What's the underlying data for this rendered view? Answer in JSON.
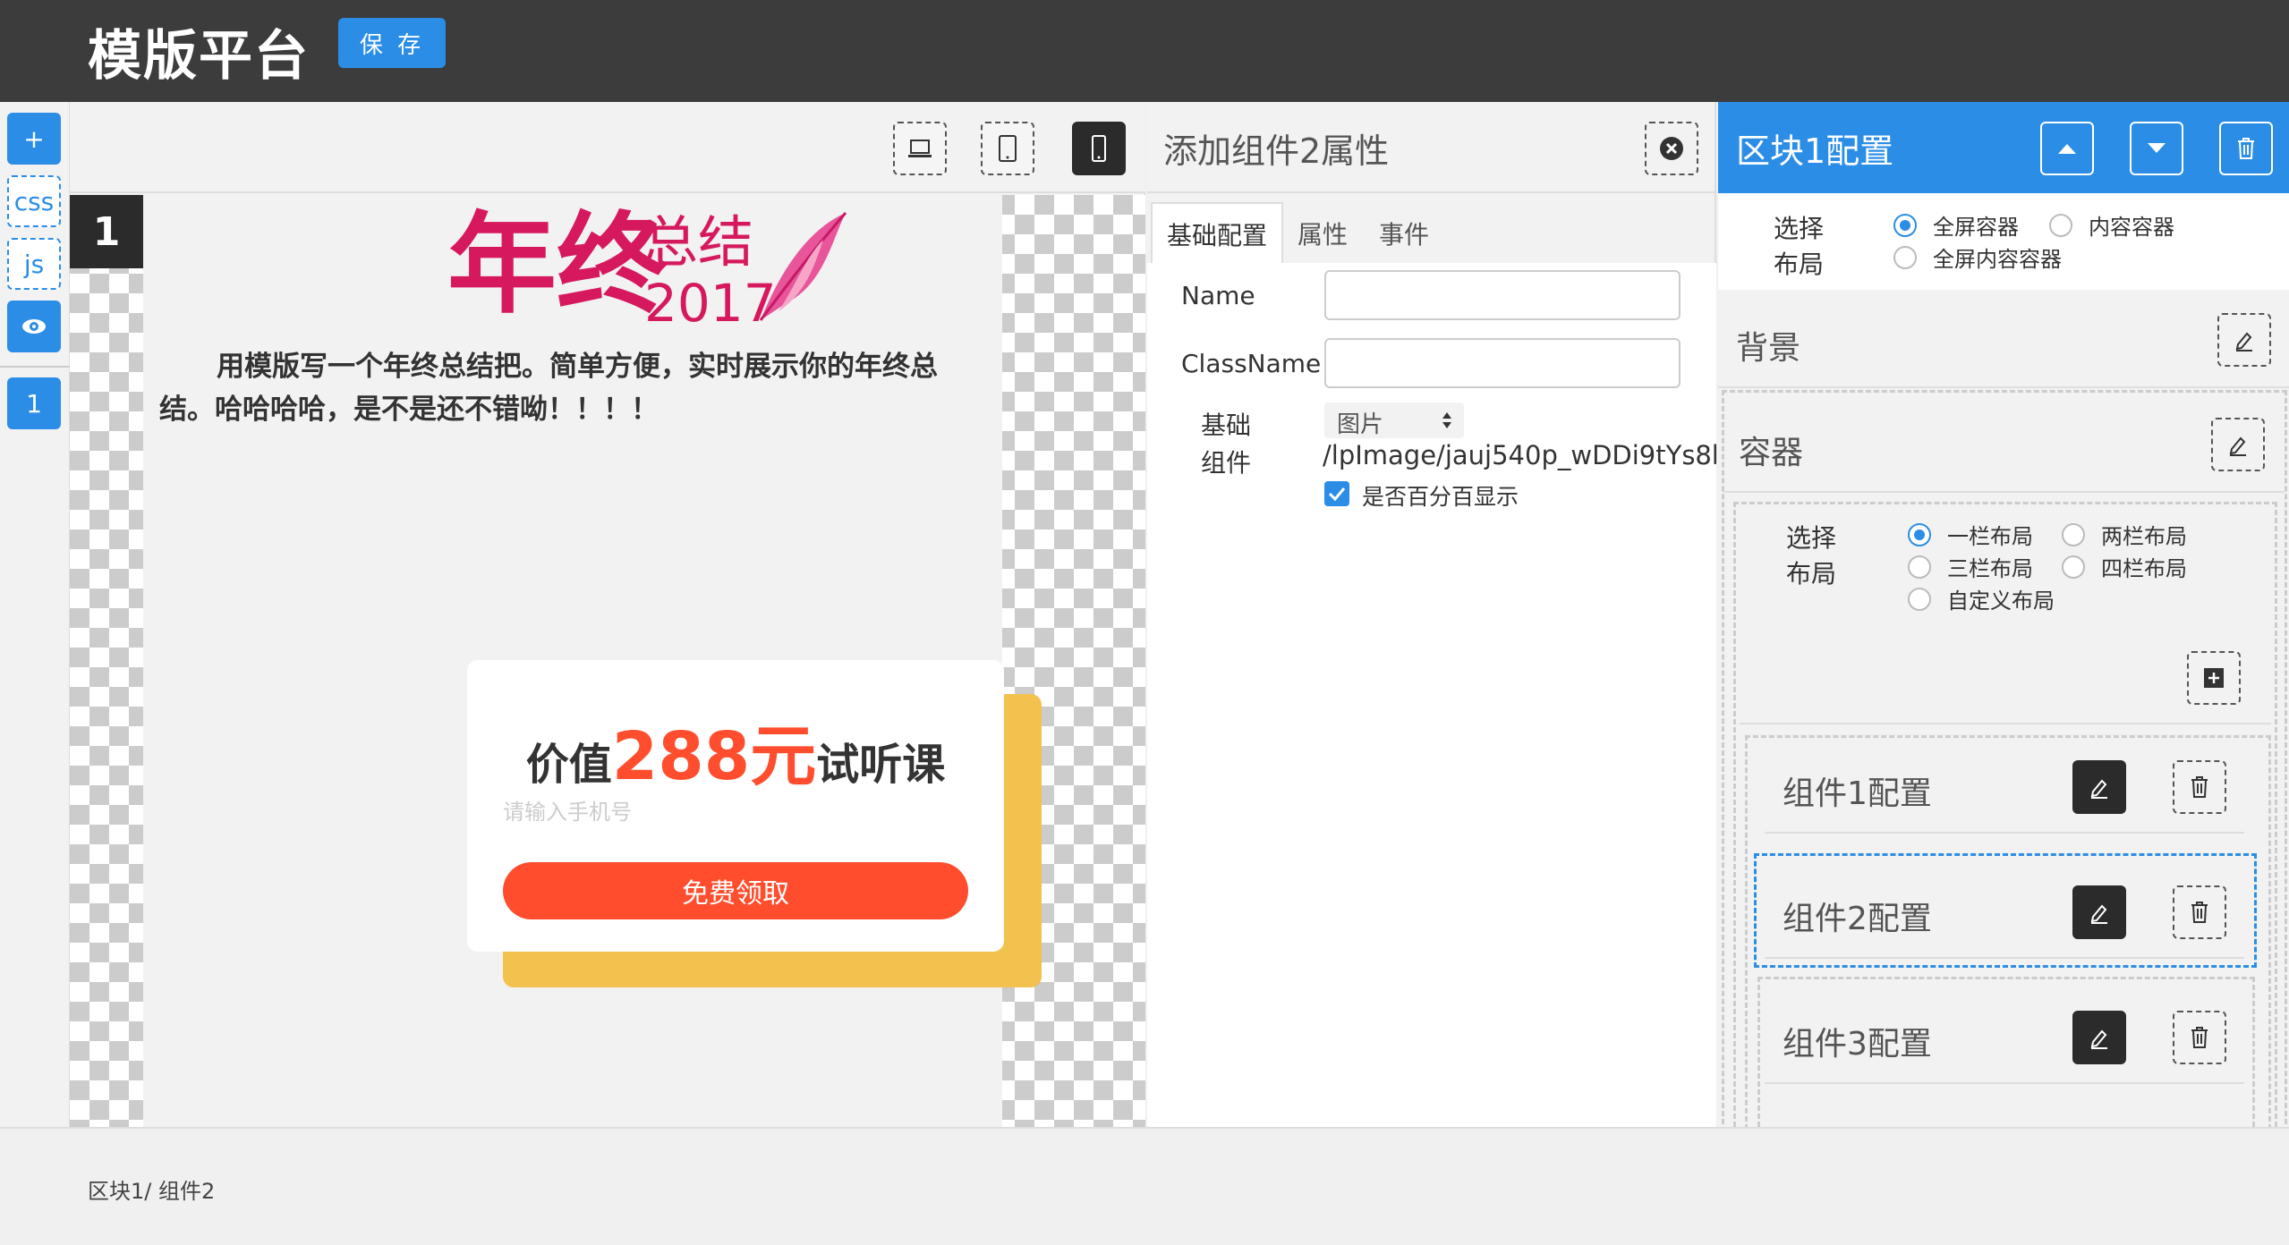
{
  "header": {
    "title": "模版平台",
    "save_label": "保 存"
  },
  "leftbar": {
    "add": "+",
    "css": "css",
    "js": "js",
    "eye_icon": "eye-icon",
    "block": "1"
  },
  "preview": {
    "block_number": "1",
    "year_title_main": "年终",
    "year_title_sub": "总结",
    "year": "2017",
    "intro_text": "用模版写一个年终总结把。简单方便，实时展示你的年终总结。哈哈哈哈，是不是还不错呦！！！！",
    "card": {
      "prefix": "价值",
      "highlight": "288元",
      "suffix": "试听课",
      "phone_placeholder": "请输入手机号",
      "button": "免费领取"
    },
    "colors": {
      "magenta": "#d6195e",
      "orange": "#ff4d2e",
      "gold": "#f2c14e"
    }
  },
  "props": {
    "title": "添加组件2属性",
    "tabs": [
      "基础配置",
      "属性",
      "事件"
    ],
    "name_label": "Name",
    "name_value": "",
    "classname_label": "ClassName",
    "classname_value": "",
    "base_label_1": "基础",
    "base_label_2": "组件",
    "component_type": "图片",
    "image_path": "/lpImage/jauj540p_wDDi9tYs8bx",
    "percent_label": "是否百分百显示",
    "percent_checked": true
  },
  "config": {
    "title": "区块1配置",
    "layout_label_1": "选择",
    "layout_label_2": "布局",
    "block_layouts": [
      "全屏容器",
      "内容容器",
      "全屏内容容器"
    ],
    "block_layout_selected": "全屏容器",
    "background_label": "背景",
    "container_label": "容器",
    "col_layouts": [
      "一栏布局",
      "两栏布局",
      "三栏布局",
      "四栏布局",
      "自定义布局"
    ],
    "col_layout_selected": "一栏布局",
    "components": [
      "组件1配置",
      "组件2配置",
      "组件3配置"
    ],
    "active_component": "组件2配置",
    "accent": "#2b8de6"
  },
  "footer": {
    "breadcrumb": "区块1/ 组件2"
  }
}
